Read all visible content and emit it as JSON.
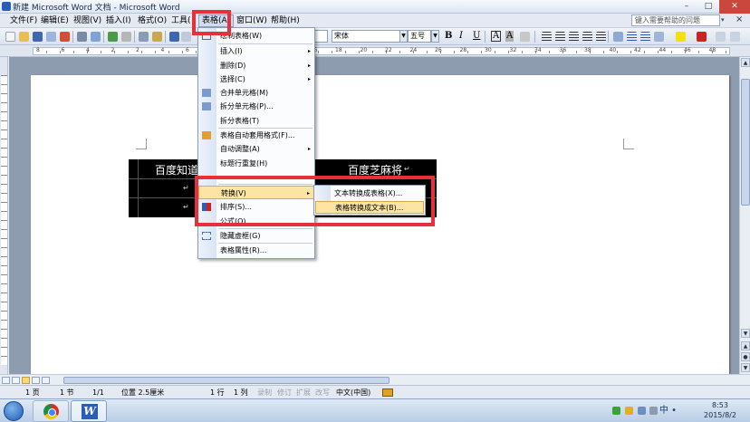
{
  "window": {
    "title": "新建 Microsoft Word 文档 - Microsoft Word",
    "minimize": "–",
    "maximize": "□",
    "close": "✕"
  },
  "menubar": {
    "items": [
      "文件(F)",
      "编辑(E)",
      "视图(V)",
      "插入(I)",
      "格式(O)",
      "工具(",
      "表格(A)",
      "窗口(W)",
      "帮助(H)"
    ],
    "help_placeholder": "键入需要帮助的问题",
    "help_drop": "▾",
    "doc_close": "×"
  },
  "toolbar": {
    "style_tail": "样",
    "font_name": "宋体",
    "font_size": "五号",
    "bold": "B",
    "italic": "I",
    "underline": "U",
    "char_border": "A",
    "char_shading": "A"
  },
  "ruler": {
    "labels": [
      "8",
      "6",
      "4",
      "2",
      "2",
      "4",
      "6",
      "8",
      "10",
      "12",
      "14",
      "16",
      "18",
      "20",
      "22",
      "24",
      "26",
      "28",
      "30",
      "32",
      "34",
      "36",
      "38",
      "40",
      "42",
      "44",
      "46",
      "48"
    ]
  },
  "document": {
    "cell_1": "百度知道",
    "cell_2": "百度芝麻将",
    "para_mark": "↵"
  },
  "table_menu": {
    "items": {
      "draw_table": "绘制表格(W)",
      "insert": "插入(I)",
      "delete": "删除(D)",
      "select": "选择(C)",
      "merge_cells": "合并单元格(M)",
      "split_cells": "拆分单元格(P)...",
      "split_table": "拆分表格(T)",
      "autoformat": "表格自动套用格式(F)...",
      "autofit": "自动调整(A)",
      "heading_repeat": "标题行重复(H)",
      "obscured": "",
      "convert": "转换(V)",
      "sort": "排序(S)...",
      "formula": "公式(O)...",
      "hide_gridlines": "隐藏虚框(G)",
      "properties": "表格属性(R)..."
    },
    "arrow": "▸"
  },
  "convert_submenu": {
    "text_to_table": "文本转换成表格(X)...",
    "table_to_text": "表格转换成文本(B)..."
  },
  "statusbar": {
    "page": "1 页",
    "section": "1 节",
    "page_of": "1/1",
    "position": "位置 2.5厘米",
    "line": "1 行",
    "col": "1 列",
    "rec": "录制",
    "trk": "修订",
    "ext": "扩展",
    "ovr": "改写",
    "language": "中文(中国)"
  },
  "taskbar": {
    "word_letter": "W",
    "ime": "中 •",
    "time": "8:53",
    "date": "2015/8/2"
  },
  "colors": {
    "annotation_red": "#e8303a",
    "menu_highlight": "#fbe4a4",
    "table_fill": "#000000"
  }
}
